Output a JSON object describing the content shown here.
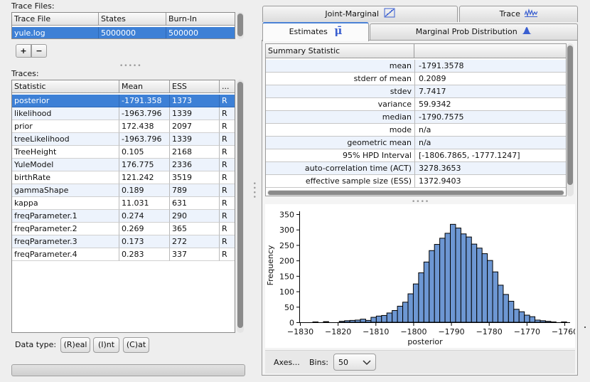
{
  "trace_files": {
    "title": "Trace Files:",
    "columns": [
      "Trace File",
      "States",
      "Burn-In"
    ],
    "rows": [
      [
        "yule.log",
        "5000000",
        "500000"
      ]
    ],
    "add_label": "+",
    "remove_label": "−"
  },
  "traces": {
    "title": "Traces:",
    "columns": [
      "Statistic",
      "Mean",
      "ESS",
      "..."
    ],
    "rows": [
      [
        "posterior",
        "-1791.358",
        "1373",
        "R"
      ],
      [
        "likelihood",
        "-1963.796",
        "1339",
        "R"
      ],
      [
        "prior",
        "172.438",
        "2097",
        "R"
      ],
      [
        "treeLikelihood",
        "-1963.796",
        "1339",
        "R"
      ],
      [
        "TreeHeight",
        "0.105",
        "2168",
        "R"
      ],
      [
        "YuleModel",
        "176.775",
        "2336",
        "R"
      ],
      [
        "birthRate",
        "121.242",
        "3519",
        "R"
      ],
      [
        "gammaShape",
        "0.189",
        "789",
        "R"
      ],
      [
        "kappa",
        "11.031",
        "631",
        "R"
      ],
      [
        "freqParameter.1",
        "0.274",
        "290",
        "R"
      ],
      [
        "freqParameter.2",
        "0.269",
        "365",
        "R"
      ],
      [
        "freqParameter.3",
        "0.173",
        "272",
        "R"
      ],
      [
        "freqParameter.4",
        "0.283",
        "337",
        "R"
      ]
    ]
  },
  "data_type": {
    "label": "Data type:",
    "buttons": [
      "(R)eal",
      "(I)nt",
      "(C)at"
    ]
  },
  "tabs_top": {
    "joint_marginal": "Joint-Marginal",
    "trace": "Trace"
  },
  "tabs_bottom": {
    "estimates": "Estimates",
    "marginal": "Marginal Prob Distribution"
  },
  "summary": {
    "header": "Summary Statistic",
    "rows": [
      [
        "mean",
        "-1791.3578"
      ],
      [
        "stderr of mean",
        "0.2089"
      ],
      [
        "stdev",
        "7.7417"
      ],
      [
        "variance",
        "59.9342"
      ],
      [
        "median",
        "-1790.7575"
      ],
      [
        "mode",
        "n/a"
      ],
      [
        "geometric mean",
        "n/a"
      ],
      [
        "95% HPD Interval",
        "[-1806.7865, -1777.1247]"
      ],
      [
        "auto-correlation time (ACT)",
        "3278.3653"
      ],
      [
        "effective sample size (ESS)",
        "1372.9403"
      ]
    ]
  },
  "footer": {
    "axes_label": "Axes...",
    "bins_label": "Bins:",
    "bins_value": "50"
  },
  "colors": {
    "bar_fill": "#6d97d3",
    "selection": "#3d80d6",
    "tab_accent": "#4b82d6"
  },
  "chart_data": {
    "type": "bar",
    "xlabel": "posterior",
    "ylabel": "Frequency",
    "xlim": [
      -1830,
      -1760
    ],
    "ylim": [
      0,
      350
    ],
    "xticks": [
      -1830,
      -1820,
      -1810,
      -1800,
      -1790,
      -1780,
      -1770,
      -1760
    ],
    "yticks": [
      0,
      50,
      100,
      150,
      200,
      250,
      300,
      350
    ],
    "bin_width": 1.4,
    "bin_start": -1826.6,
    "values": [
      1,
      0,
      2,
      0,
      0,
      3,
      5,
      6,
      7,
      10,
      6,
      16,
      20,
      22,
      30,
      38,
      52,
      65,
      92,
      124,
      160,
      195,
      232,
      252,
      272,
      288,
      317,
      305,
      286,
      276,
      253,
      240,
      222,
      200,
      163,
      120,
      90,
      68,
      42,
      34,
      23,
      18,
      7,
      5,
      3,
      1,
      0,
      1,
      0,
      0
    ],
    "grid": false,
    "legend": "none"
  }
}
